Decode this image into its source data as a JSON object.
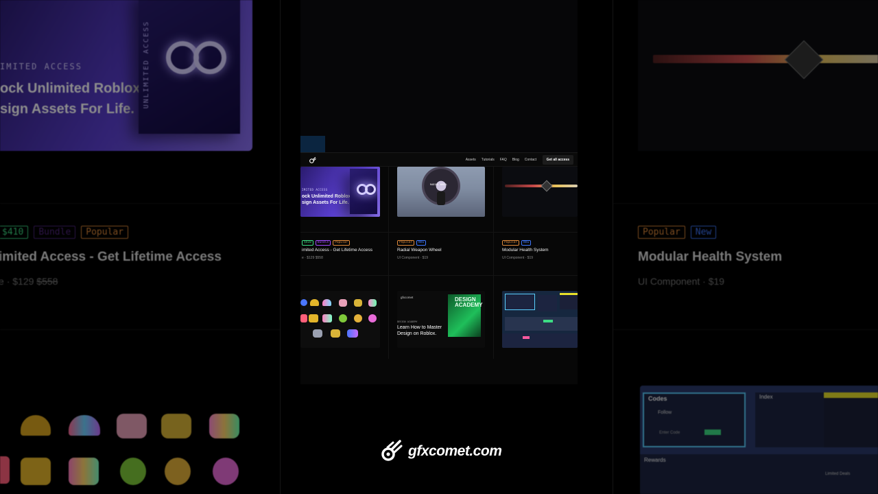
{
  "left_panel": {
    "access_label": "IMITED ACCESS",
    "headline_line1": "ock Unlimited Roblox",
    "headline_line2": "sign Assets For Life.",
    "box_side_text": "UNLIMITED ACCESS",
    "tags": [
      "$410",
      "Bundle",
      "Popular"
    ],
    "title": "imited Access - Get Lifetime Access",
    "meta_prefix": "e",
    "price": "$129",
    "old_price": "$558"
  },
  "right_panel": {
    "tags": [
      "Popular",
      "New"
    ],
    "title": "Modular Health System",
    "meta": "UI Component",
    "price": "$19",
    "ui_texts": {
      "codes": "Codes",
      "index": "Index",
      "follow": "Follow",
      "enter_code": "Enter Code",
      "rewards": "Rewards",
      "limited": "Limited Deals"
    }
  },
  "site": {
    "nav": {
      "links": [
        "Assets",
        "Tutorials",
        "FAQ",
        "Blog",
        "Contact"
      ],
      "cta": "Get all access"
    },
    "cards": [
      {
        "thumb_label": "IMITED ACCESS",
        "thumb_line1": "ock Unlimited Roblox",
        "thumb_line2": "sign Assets For Life.",
        "tags": [
          "$410",
          "Bundle",
          "Popular"
        ],
        "title": "imited Access - Get Lifetime Access",
        "meta": "e  ·  $129  $558"
      },
      {
        "thumb_label": "RADIAL WHEEL",
        "tags": [
          "Popular",
          "New"
        ],
        "title": "Radial Weapon Wheel",
        "meta": "UI Component  ·  $19"
      },
      {
        "tags": [
          "Popular",
          "New"
        ],
        "title": "Modular Health System",
        "meta": "UI Component  ·  $19"
      },
      {
        "thumb_kind": "icons"
      },
      {
        "brand": "gfxcomet",
        "kicker": "DESIGN ACADEMY",
        "line1": "Learn How to Master",
        "line2": "Design on Roblox.",
        "box_title": "DESIGN ACADEMY"
      },
      {
        "thumb_kind": "ui-kit"
      }
    ]
  },
  "footer": {
    "brand": "gfxcomet.com"
  },
  "colors": {
    "tag_green": "#3ddc84",
    "tag_purple": "#a24bff",
    "tag_orange": "#e08a3a",
    "tag_blue": "#3f78ff",
    "promo_purple": "#5a3fd0"
  }
}
